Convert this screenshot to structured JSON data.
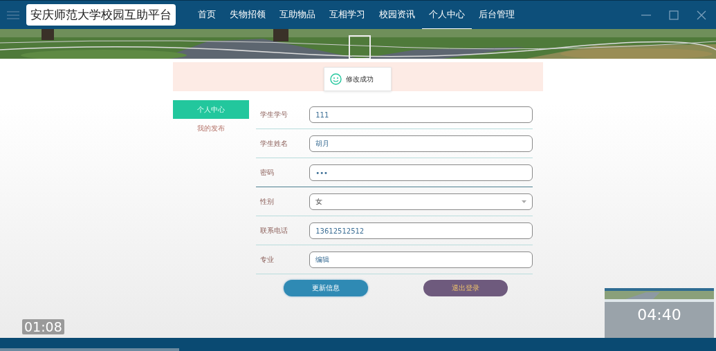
{
  "site_title": "安庆师范大学校园互助平台",
  "nav": [
    {
      "label": "首页",
      "selected": false
    },
    {
      "label": "失物招领",
      "selected": false
    },
    {
      "label": "互助物品",
      "selected": false
    },
    {
      "label": "互相学习",
      "selected": false
    },
    {
      "label": "校园资讯",
      "selected": false
    },
    {
      "label": "个人中心",
      "selected": true
    },
    {
      "label": "后台管理",
      "selected": false
    }
  ],
  "toast": {
    "message": "修改成功"
  },
  "sidebar": [
    {
      "label": "个人中心",
      "selected": true
    },
    {
      "label": "我的发布",
      "selected": false
    }
  ],
  "form": [
    {
      "label": "学生学号",
      "kind": "text",
      "value": "111"
    },
    {
      "label": "学生姓名",
      "kind": "text",
      "value": "胡月"
    },
    {
      "label": "密码",
      "kind": "text",
      "value": "•••"
    },
    {
      "label": "性别",
      "kind": "select",
      "value": "女"
    },
    {
      "label": "联系电话",
      "kind": "text",
      "value": "13612512512"
    },
    {
      "label": "专业",
      "kind": "text",
      "value": "编辑"
    }
  ],
  "buttons": [
    {
      "label": "更新信息",
      "kind": "primary"
    },
    {
      "label": "退出登录",
      "kind": "secondary"
    }
  ],
  "player": {
    "time": "01:08",
    "preview_time": "04:40",
    "level": 0.25
  }
}
